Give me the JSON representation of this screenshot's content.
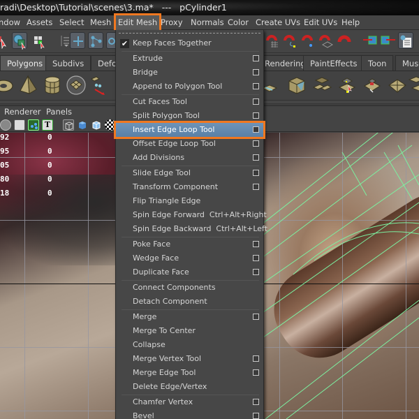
{
  "window": {
    "title": "radi\\Desktop\\Tutorial\\scenes\\3.ma*   ---   pCylinder1"
  },
  "menubar": {
    "items": [
      {
        "label": "ndow"
      },
      {
        "label": "Assets"
      },
      {
        "label": "Select"
      },
      {
        "label": "Mesh"
      },
      {
        "label": "Edit Mesh",
        "active": true
      },
      {
        "label": "Proxy"
      },
      {
        "label": "Normals"
      },
      {
        "label": "Color"
      },
      {
        "label": "Create UVs"
      },
      {
        "label": "Edit UVs"
      },
      {
        "label": "Help"
      }
    ]
  },
  "status_toolbar": {
    "icons": [
      "select-by-hierarchy-icon",
      "select-by-object-icon",
      "select-by-component-icon",
      "move-pivot-icon",
      "snap-to-grid-icon",
      "snap-to-curve-icon",
      "snap-to-point-icon",
      "snap-to-view-plane-icon",
      "make-live-icon",
      "input-ops-icon",
      "output-ops-icon",
      "render-history-icon"
    ]
  },
  "shelf_tabs": {
    "tabs": [
      {
        "label": "Polygons",
        "selected": true
      },
      {
        "label": "Subdivs"
      },
      {
        "label": "Defo"
      },
      {
        "label": "Rendering"
      },
      {
        "label": "PaintEffects"
      },
      {
        "label": "Toon"
      },
      {
        "label": "Musc"
      }
    ]
  },
  "shelf": {
    "icons": [
      "poly-torus-icon",
      "poly-pyramid-icon",
      "poly-cylinder-icon",
      "poly-plane-icon",
      "separate-icon",
      "extract-icon",
      "poly-cube-face-icon",
      "poly-split-icon",
      "insert-edge-loop-icon",
      "wedge-face-icon",
      "triangulate-icon",
      "combine-icon"
    ]
  },
  "panel_menu": {
    "items": [
      {
        "label": "Renderer"
      },
      {
        "label": "Panels"
      }
    ]
  },
  "hud": {
    "rows": [
      {
        "a": "92",
        "b": "0"
      },
      {
        "a": "95",
        "b": "0"
      },
      {
        "a": "05",
        "b": "0"
      },
      {
        "a": "80",
        "b": "0"
      },
      {
        "a": "18",
        "b": "0"
      }
    ]
  },
  "edit_mesh_menu": {
    "items": [
      {
        "label": "Keep Faces Together",
        "checked": true,
        "option": false
      },
      {
        "sep": true
      },
      {
        "label": "Extrude",
        "option": true
      },
      {
        "label": "Bridge",
        "option": true
      },
      {
        "label": "Append to Polygon Tool",
        "option": true
      },
      {
        "sep": true
      },
      {
        "label": "Cut Faces Tool",
        "option": true
      },
      {
        "label": "Split Polygon Tool",
        "option": true
      },
      {
        "label": "Insert Edge Loop Tool",
        "option": true,
        "highlight": true
      },
      {
        "label": "Offset Edge Loop Tool",
        "option": true
      },
      {
        "label": "Add Divisions",
        "option": true
      },
      {
        "sep": true
      },
      {
        "label": "Slide Edge Tool",
        "option": true
      },
      {
        "label": "Transform Component",
        "option": true
      },
      {
        "label": "Flip Triangle Edge",
        "option": false
      },
      {
        "label": "Spin Edge Forward  Ctrl+Alt+Right",
        "option": false
      },
      {
        "label": "Spin Edge Backward  Ctrl+Alt+Left",
        "option": false
      },
      {
        "sep": true
      },
      {
        "label": "Poke Face",
        "option": true
      },
      {
        "label": "Wedge Face",
        "option": true
      },
      {
        "label": "Duplicate Face",
        "option": true
      },
      {
        "sep": true
      },
      {
        "label": "Connect Components",
        "option": false
      },
      {
        "label": "Detach Component",
        "option": false
      },
      {
        "sep": true
      },
      {
        "label": "Merge",
        "option": true
      },
      {
        "label": "Merge To Center",
        "option": false
      },
      {
        "label": "Collapse",
        "option": false
      },
      {
        "label": "Merge Vertex Tool",
        "option": true
      },
      {
        "label": "Merge Edge Tool",
        "option": true
      },
      {
        "label": "Delete Edge/Vertex",
        "option": false
      },
      {
        "sep": true
      },
      {
        "label": "Chamfer Vertex",
        "option": true
      },
      {
        "label": "Bevel",
        "option": true
      }
    ]
  },
  "colors": {
    "highlight_outline": "#f07820",
    "menu_selection": "#6d93b8",
    "wireframe": "#7cf0a0"
  }
}
